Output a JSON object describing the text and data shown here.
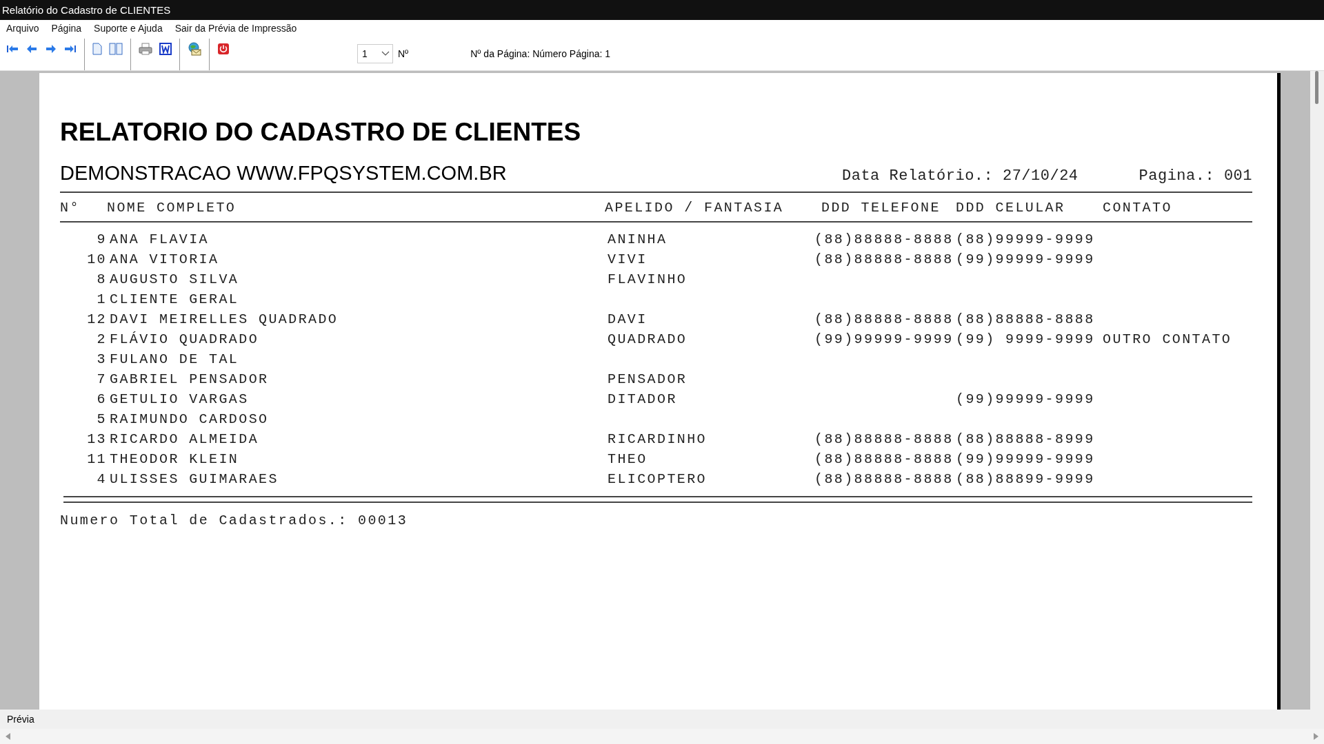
{
  "window": {
    "title": "Relatório do Cadastro de CLIENTES"
  },
  "menu": [
    "Arquivo",
    "Página",
    "Suporte e Ajuda",
    "Sair da Prévia de Impressão"
  ],
  "toolbar": {
    "page_select": {
      "value": "1"
    },
    "page_label": "Nº",
    "page_info": "Nº da Página: Número Página: 1"
  },
  "report": {
    "title": "RELATORIO DO CADASTRO DE CLIENTES",
    "subtitle": "DEMONSTRACAO WWW.FPQSYSTEM.COM.BR",
    "date": "Data Relatório.: 27/10/24",
    "page": "Pagina.: 001",
    "columns": [
      "N°",
      "NOME COMPLETO",
      "APELIDO / FANTASIA",
      "DDD TELEFONE",
      "DDD CELULAR",
      "CONTATO"
    ],
    "rows": [
      {
        "numero": "9",
        "nome": "ANA FLAVIA",
        "apelido": "ANINHA",
        "telefone": "(88)88888-8888",
        "celular": "(88)99999-9999"
      },
      {
        "numero": "10",
        "nome": "ANA VITORIA",
        "apelido": "VIVI",
        "telefone": "(88)88888-8888",
        "celular": "(99)99999-9999"
      },
      {
        "numero": "8",
        "nome": "AUGUSTO SILVA",
        "apelido": "FLAVINHO"
      },
      {
        "numero": "1",
        "nome": "CLIENTE GERAL"
      },
      {
        "numero": "12",
        "nome": "DAVI MEIRELLES QUADRADO",
        "apelido": "DAVI",
        "telefone": "(88)88888-8888",
        "celular": "(88)88888-8888"
      },
      {
        "numero": "2",
        "nome": "FLÁVIO QUADRADO",
        "apelido": "QUADRADO",
        "telefone": "(99)99999-9999",
        "celular": "(99)  9999-9999",
        "contato": "OUTRO CONTATO"
      },
      {
        "numero": "3",
        "nome": "FULANO DE TAL"
      },
      {
        "numero": "7",
        "nome": "GABRIEL PENSADOR",
        "apelido": "PENSADOR"
      },
      {
        "numero": "6",
        "nome": "GETULIO VARGAS",
        "apelido": "DITADOR",
        "celular": "(99)99999-9999"
      },
      {
        "numero": "5",
        "nome": "RAIMUNDO CARDOSO"
      },
      {
        "numero": "13",
        "nome": "RICARDO ALMEIDA",
        "apelido": "RICARDINHO",
        "telefone": "(88)88888-8888",
        "celular": "(88)88888-8999"
      },
      {
        "numero": "11",
        "nome": "THEODOR KLEIN",
        "apelido": "THEO",
        "telefone": "(88)88888-8888",
        "celular": "(99)99999-9999"
      },
      {
        "numero": "4",
        "nome": "ULISSES GUIMARAES",
        "apelido": "ELICOPTERO",
        "telefone": "(88)88888-8888",
        "celular": "(88)88899-9999"
      }
    ],
    "total": "Numero Total de Cadastrados.: 00013"
  },
  "status_bar": "Prévia"
}
